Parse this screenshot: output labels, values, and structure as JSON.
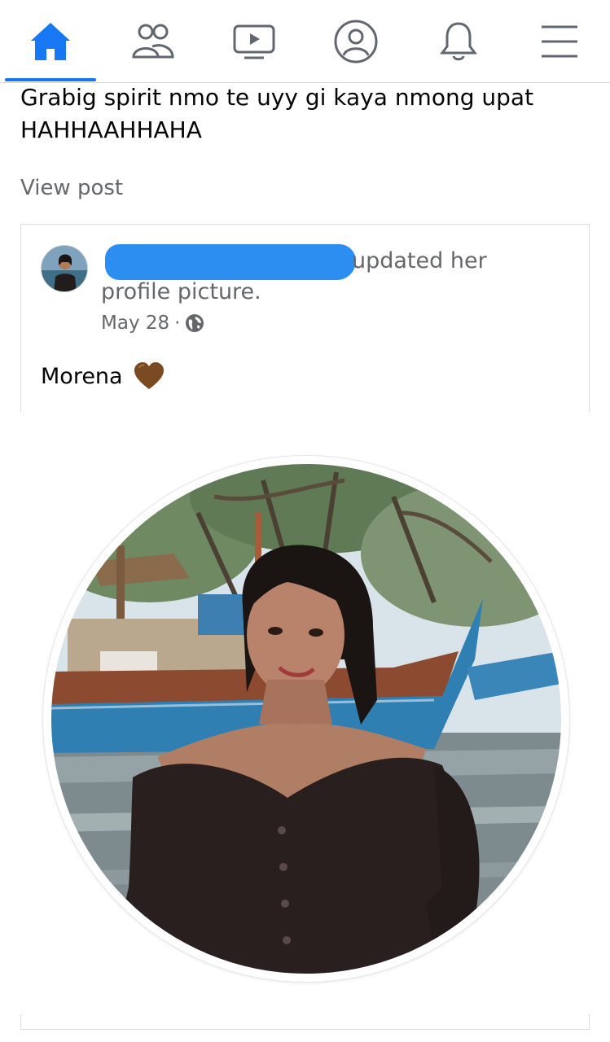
{
  "nav": {
    "items": [
      {
        "name": "home-icon",
        "active": true
      },
      {
        "name": "friends-icon",
        "active": false
      },
      {
        "name": "watch-icon",
        "active": false
      },
      {
        "name": "profile-icon",
        "active": false
      },
      {
        "name": "notifications-bell-icon",
        "active": false
      },
      {
        "name": "menu-icon",
        "active": false
      }
    ],
    "accent_color": "#1877f2",
    "icon_color": "#606770"
  },
  "post": {
    "text": "Grabig spirit nmo te uyy gi kaya nmong upat HAHHAAHHAHA",
    "view_post_label": "View post"
  },
  "shared_card": {
    "action_text": "updated her profile picture.",
    "date": "May 28",
    "separator": "·",
    "privacy_icon": "globe-icon",
    "caption": "Morena",
    "caption_emoji": "brown-heart",
    "redaction_color": "#2c8ef0"
  }
}
